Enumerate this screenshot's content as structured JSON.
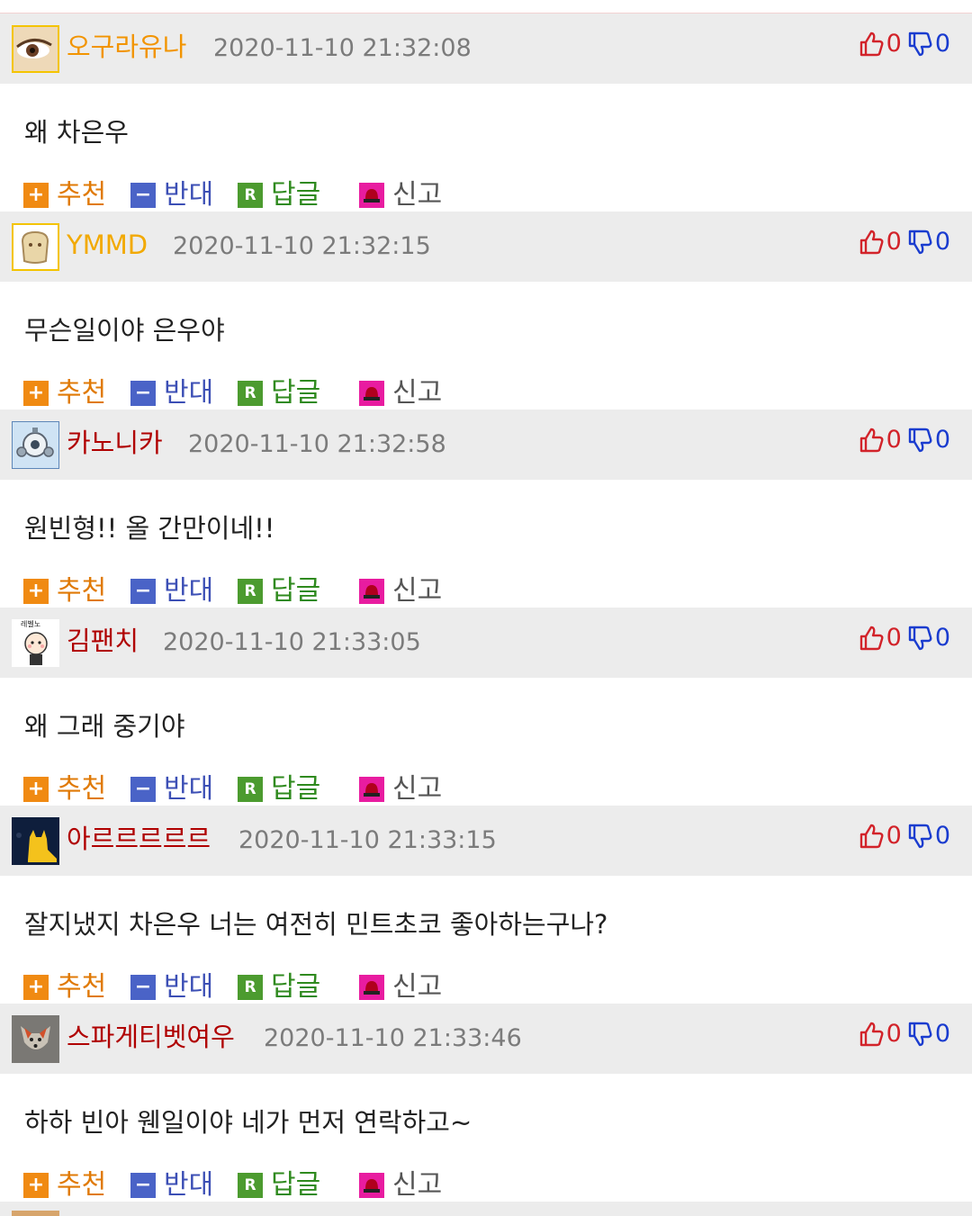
{
  "comments": [
    {
      "nick": "오구라유나",
      "nick_color": "#f29400",
      "date": "2020-11-10 21:32:08",
      "up": "0",
      "down": "0",
      "text": "왜 차은우"
    },
    {
      "nick": "YMMD",
      "nick_color": "#f2a900",
      "date": "2020-11-10 21:32:15",
      "up": "0",
      "down": "0",
      "text": "무슨일이야 은우야"
    },
    {
      "nick": "카노니카",
      "nick_color": "#b00000",
      "date": "2020-11-10 21:32:58",
      "up": "0",
      "down": "0",
      "text": "원빈형!! 올 간만이네!!"
    },
    {
      "nick": "김팬치",
      "nick_color": "#b00000",
      "date": "2020-11-10 21:33:05",
      "up": "0",
      "down": "0",
      "text": "왜 그래 중기야"
    },
    {
      "nick": "아르르르르르",
      "nick_color": "#b00000",
      "date": "2020-11-10 21:33:15",
      "up": "0",
      "down": "0",
      "text": "잘지냈지 차은우 너는 여전히 민트초코 좋아하는구나?"
    },
    {
      "nick": "스파게티벳여우",
      "nick_color": "#b00000",
      "date": "2020-11-10 21:33:46",
      "up": "0",
      "down": "0",
      "text": "하하 빈아 웬일이야 네가 먼저 연락하고~"
    }
  ],
  "avatar_badge_text": "레벨노",
  "actions": {
    "recommend": "추천",
    "oppose": "반대",
    "reply": "답글",
    "report": "신고",
    "reply_icon_letter": "R"
  },
  "icons": {
    "thumb_up": "thumb-up-icon",
    "thumb_down": "thumb-down-icon",
    "plus": "plus-icon",
    "minus": "minus-icon",
    "reply": "reply-icon",
    "siren": "siren-icon"
  }
}
